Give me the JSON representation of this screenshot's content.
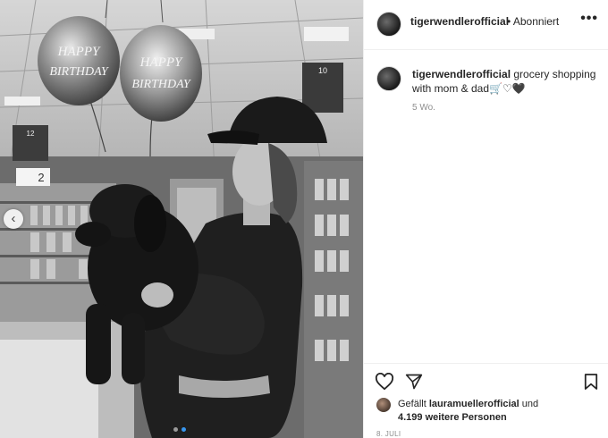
{
  "post": {
    "username": "tigerwendlerofficial",
    "follow_status": "• Abonniert",
    "more_label": "•••"
  },
  "photo": {
    "balloon_left_top": "HAPPY",
    "balloon_left_bottom": "BIRTHDAY",
    "balloon_right_top": "HAPPY",
    "balloon_right_bottom": "BIRTHDAY",
    "sign_12": "12",
    "sign_10": "10",
    "sign_2": "2",
    "carousel": {
      "total": 2,
      "active": 2
    }
  },
  "caption": {
    "username": "tigerwendlerofficial",
    "text": "grocery shopping with mom & dad🛒♡🖤",
    "time": "5 Wo."
  },
  "likes": {
    "prefix": "Gefällt ",
    "user": "lauramuellerofficial",
    "joiner": " und",
    "count": "4.199 weitere Personen"
  },
  "date": "8. JULI",
  "icons": {
    "like": "heart-outline-icon",
    "share": "paper-plane-icon",
    "save": "bookmark-icon",
    "prev": "chevron-left-icon"
  }
}
